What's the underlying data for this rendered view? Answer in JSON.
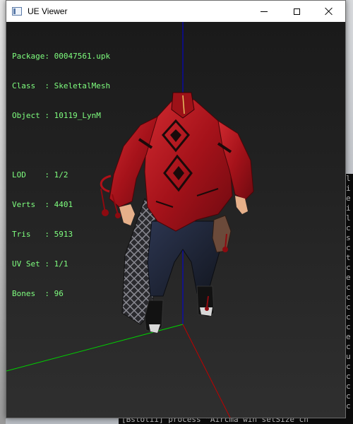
{
  "window": {
    "title": "UE Viewer"
  },
  "info": {
    "package": {
      "label": "Package",
      "value": "00047561.upk"
    },
    "class": {
      "label": "Class  ",
      "value": "SkeletalMesh"
    },
    "object": {
      "label": "Object ",
      "value": "10119_LynM"
    },
    "lod": {
      "label": "LOD    ",
      "value": "1/2"
    },
    "verts": {
      "label": "Verts  ",
      "value": "4401"
    },
    "tris": {
      "label": "Tris   ",
      "value": "5913"
    },
    "uvset": {
      "label": "UV Set ",
      "value": "1/1"
    },
    "bones": {
      "label": "Bones  ",
      "value": "96"
    }
  },
  "background": {
    "console_lines": [
      "l",
      "i",
      "e",
      "i",
      "l",
      "c",
      "s",
      "c",
      "t",
      "c",
      "e",
      "c",
      "c",
      "c",
      "c",
      "c",
      "e",
      "c",
      "u",
      "c",
      "c",
      "c",
      "c",
      "c"
    ],
    "bottom_console": "[Bstotii] process  ”Aircma win setSize  cn"
  },
  "colors": {
    "text_green": "#7fff7f",
    "axis_x": "#00d000",
    "axis_y": "#c00000",
    "axis_z": "#0000e0",
    "garment_red": "#b4131b",
    "trouser_navy": "#1c2233"
  }
}
